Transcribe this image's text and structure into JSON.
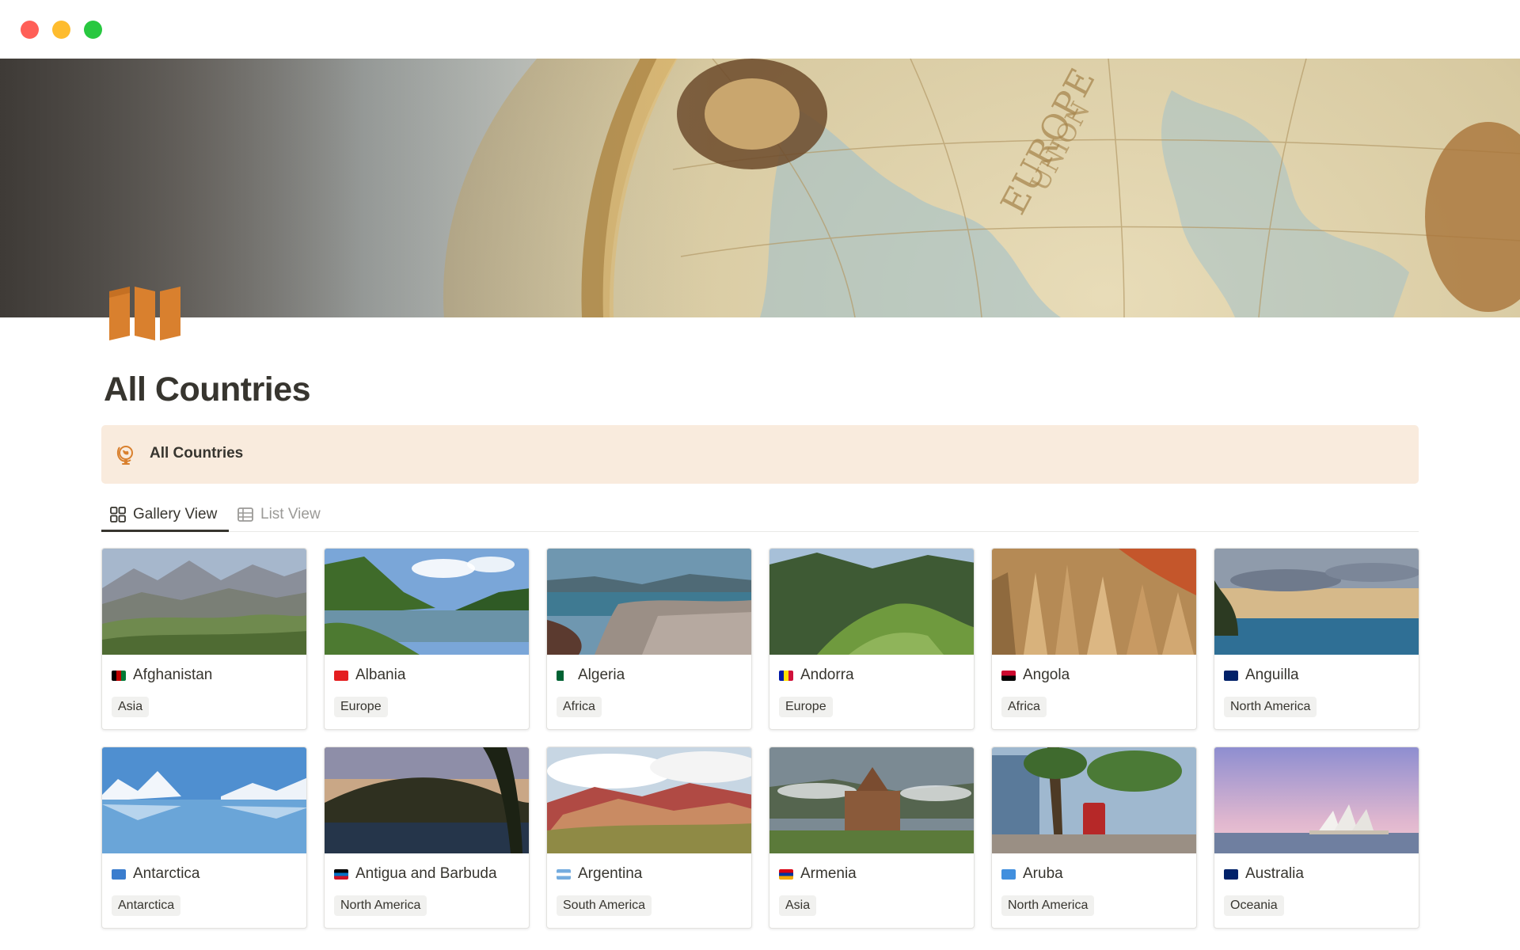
{
  "window": {
    "controls": [
      "close",
      "minimize",
      "maximize"
    ]
  },
  "page": {
    "title": "All Countries",
    "icon": "map-icon",
    "cover": "globe-cover-image"
  },
  "callout": {
    "icon": "globe-icon",
    "text": "All Countries"
  },
  "views": [
    {
      "label": "Gallery View",
      "icon": "gallery-icon",
      "active": true
    },
    {
      "label": "List View",
      "icon": "table-icon",
      "active": false
    }
  ],
  "cards": [
    {
      "name": "Afghanistan",
      "continent": "Asia",
      "image": "mountain-valley-photo"
    },
    {
      "name": "Albania",
      "continent": "Europe",
      "image": "lake-hills-photo"
    },
    {
      "name": "Algeria",
      "continent": "Africa",
      "image": "coastal-city-photo"
    },
    {
      "name": "Andorra",
      "continent": "Europe",
      "image": "green-mountains-photo"
    },
    {
      "name": "Angola",
      "continent": "Africa",
      "image": "canyon-rocks-photo"
    },
    {
      "name": "Anguilla",
      "continent": "North America",
      "image": "infinity-pool-sunset-photo"
    },
    {
      "name": "Antarctica",
      "continent": "Antarctica",
      "image": "icy-water-photo"
    },
    {
      "name": "Antigua and Barbuda",
      "continent": "North America",
      "image": "tropical-harbor-photo"
    },
    {
      "name": "Argentina",
      "continent": "South America",
      "image": "rainbow-mountains-photo"
    },
    {
      "name": "Armenia",
      "continent": "Asia",
      "image": "stone-monastery-photo"
    },
    {
      "name": "Aruba",
      "continent": "North America",
      "image": "palm-street-tram-photo"
    },
    {
      "name": "Australia",
      "continent": "Oceania",
      "image": "sydney-opera-house-photo"
    }
  ]
}
